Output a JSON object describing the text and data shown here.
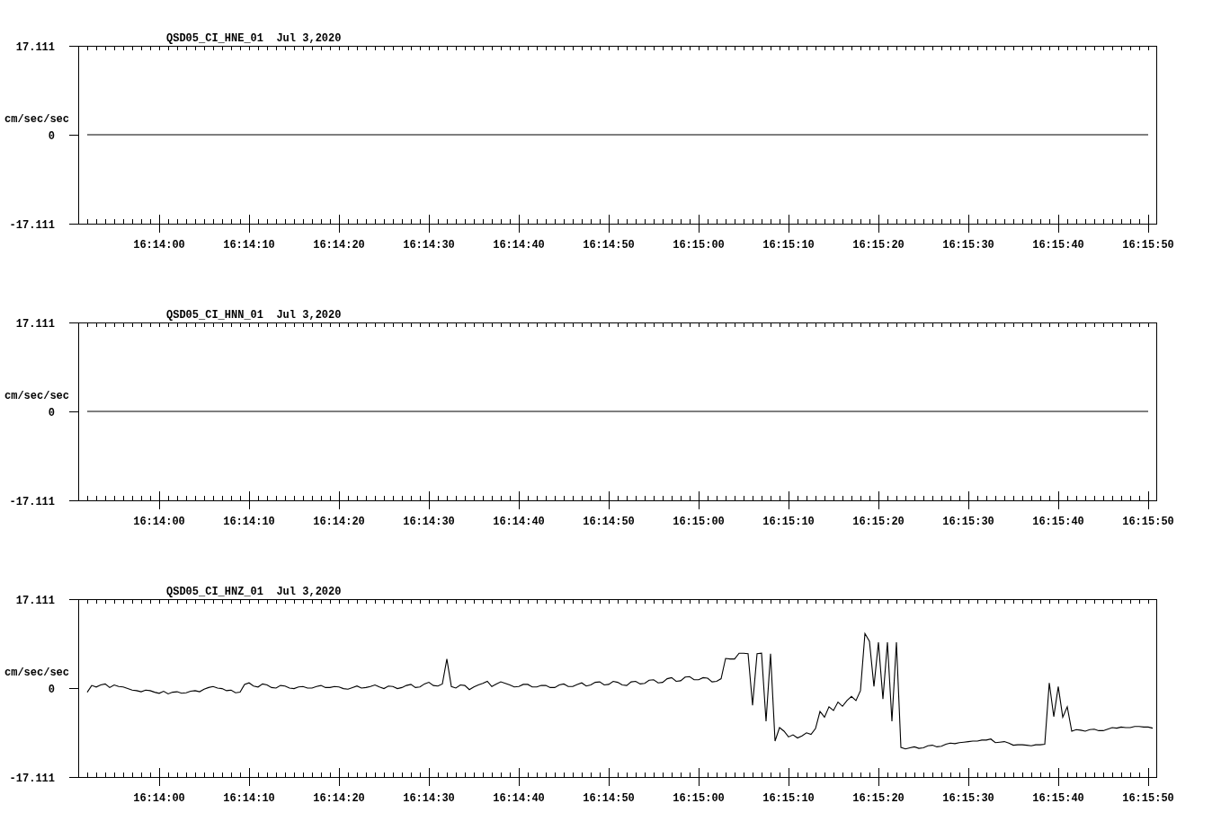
{
  "plots": [
    {
      "chart_data": {
        "type": "line",
        "title": "QSD05_CI_HNE_01  Jul 3,2020",
        "ylabel": "cm/sec/sec",
        "categories": [
          null,
          null,
          null,
          null,
          null,
          null,
          null,
          null,
          "16:14:00",
          null,
          null,
          null,
          null,
          null,
          null,
          null,
          null,
          null,
          "16:14:10",
          null,
          null,
          null,
          null,
          null,
          null,
          null,
          null,
          null,
          "16:14:20",
          null,
          null,
          null,
          null,
          null,
          null,
          null,
          null,
          null,
          "16:14:30",
          null,
          null,
          null,
          null,
          null,
          null,
          null,
          null,
          null,
          "16:14:40",
          null,
          null,
          null,
          null,
          null,
          null,
          null,
          null,
          null,
          "16:14:50",
          null,
          null,
          null,
          null,
          null,
          null,
          null,
          null,
          null,
          "16:15:00",
          null,
          null,
          null,
          null,
          null,
          null,
          null,
          null,
          null,
          "16:15:10",
          null,
          null,
          null,
          null,
          null,
          null,
          null,
          null,
          null,
          "16:15:20",
          null,
          null,
          null,
          null,
          null,
          null,
          null,
          null,
          null,
          "16:15:30",
          null,
          null,
          null,
          null,
          null,
          null,
          null,
          null,
          null,
          "16:15:40",
          null,
          null,
          null,
          null,
          null,
          null,
          null,
          null,
          null,
          "16:15:50"
        ],
        "values": [
          0,
          0,
          0,
          0,
          0,
          0,
          0,
          0,
          0,
          0,
          0,
          0,
          0,
          0,
          0,
          0,
          0,
          0,
          0,
          0,
          0,
          0,
          0,
          0,
          0,
          0,
          0,
          0,
          0,
          0,
          0,
          0,
          0,
          0,
          0,
          0,
          0,
          0,
          0,
          0,
          0,
          0,
          0,
          0,
          0,
          0,
          0,
          0,
          0,
          0,
          0,
          0,
          0,
          0,
          0,
          0,
          0,
          0,
          0,
          0,
          0,
          0,
          0,
          0,
          0,
          0,
          0,
          0,
          0,
          0,
          0,
          0,
          0,
          0,
          0,
          0,
          0,
          0,
          0,
          0,
          0,
          0,
          0,
          0,
          0,
          0,
          0,
          0,
          0,
          0,
          0,
          0,
          0,
          0,
          0,
          0,
          0,
          0,
          0,
          0,
          0,
          0,
          0,
          0,
          0,
          0,
          0,
          0,
          0,
          0,
          0,
          0,
          0,
          0,
          0,
          0,
          0,
          0,
          0
        ],
        "ylim": [
          -17.111,
          17.111
        ],
        "yticks": [
          {
            "value": 17.111,
            "label": "17.111"
          },
          {
            "value": 0,
            "label": "0"
          },
          {
            "value": -17.111,
            "label": "-17.111"
          }
        ]
      }
    },
    {
      "chart_data": {
        "type": "line",
        "title": "QSD05_CI_HNN_01  Jul 3,2020",
        "ylabel": "cm/sec/sec",
        "categories": [
          null,
          null,
          null,
          null,
          null,
          null,
          null,
          null,
          "16:14:00",
          null,
          null,
          null,
          null,
          null,
          null,
          null,
          null,
          null,
          "16:14:10",
          null,
          null,
          null,
          null,
          null,
          null,
          null,
          null,
          null,
          "16:14:20",
          null,
          null,
          null,
          null,
          null,
          null,
          null,
          null,
          null,
          "16:14:30",
          null,
          null,
          null,
          null,
          null,
          null,
          null,
          null,
          null,
          "16:14:40",
          null,
          null,
          null,
          null,
          null,
          null,
          null,
          null,
          null,
          "16:14:50",
          null,
          null,
          null,
          null,
          null,
          null,
          null,
          null,
          null,
          "16:15:00",
          null,
          null,
          null,
          null,
          null,
          null,
          null,
          null,
          null,
          "16:15:10",
          null,
          null,
          null,
          null,
          null,
          null,
          null,
          null,
          null,
          "16:15:20",
          null,
          null,
          null,
          null,
          null,
          null,
          null,
          null,
          null,
          "16:15:30",
          null,
          null,
          null,
          null,
          null,
          null,
          null,
          null,
          null,
          "16:15:40",
          null,
          null,
          null,
          null,
          null,
          null,
          null,
          null,
          null,
          "16:15:50"
        ],
        "values": [
          0,
          0,
          0,
          0,
          0,
          0,
          0,
          0,
          0,
          0,
          0,
          0,
          0,
          0,
          0,
          0,
          0,
          0,
          0,
          0,
          0,
          0,
          0,
          0,
          0,
          0,
          0,
          0,
          0,
          0,
          0,
          0,
          0,
          0,
          0,
          0,
          0,
          0,
          0,
          0,
          0,
          0,
          0,
          0,
          0,
          0,
          0,
          0,
          0,
          0,
          0,
          0,
          0,
          0,
          0,
          0,
          0,
          0,
          0,
          0,
          0,
          0,
          0,
          0,
          0,
          0,
          0,
          0,
          0,
          0,
          0,
          0,
          0,
          0,
          0,
          0,
          0,
          0,
          0,
          0,
          0,
          0,
          0,
          0,
          0,
          0,
          0,
          0,
          0,
          0,
          0,
          0,
          0,
          0,
          0,
          0,
          0,
          0,
          0,
          0,
          0,
          0,
          0,
          0,
          0,
          0,
          0,
          0,
          0,
          0,
          0,
          0,
          0,
          0,
          0,
          0,
          0,
          0,
          0
        ],
        "ylim": [
          -17.111,
          17.111
        ],
        "yticks": [
          {
            "value": 17.111,
            "label": "17.111"
          },
          {
            "value": 0,
            "label": "0"
          },
          {
            "value": -17.111,
            "label": "-17.111"
          }
        ]
      }
    },
    {
      "chart_data": {
        "type": "line",
        "title": "QSD05_CI_HNZ_01  Jul 3,2020",
        "ylabel": "cm/sec/sec",
        "categories": [
          null,
          null,
          null,
          null,
          null,
          null,
          null,
          null,
          null,
          null,
          null,
          null,
          null,
          null,
          null,
          null,
          "16:14:00",
          null,
          null,
          null,
          null,
          null,
          null,
          null,
          null,
          null,
          null,
          null,
          null,
          null,
          null,
          null,
          null,
          null,
          null,
          null,
          "16:14:10",
          null,
          null,
          null,
          null,
          null,
          null,
          null,
          null,
          null,
          null,
          null,
          null,
          null,
          null,
          null,
          null,
          null,
          null,
          null,
          "16:14:20",
          null,
          null,
          null,
          null,
          null,
          null,
          null,
          null,
          null,
          null,
          null,
          null,
          null,
          null,
          null,
          null,
          null,
          null,
          null,
          "16:14:30",
          null,
          null,
          null,
          null,
          null,
          null,
          null,
          null,
          null,
          null,
          null,
          null,
          null,
          null,
          null,
          null,
          null,
          null,
          null,
          "16:14:40",
          null,
          null,
          null,
          null,
          null,
          null,
          null,
          null,
          null,
          null,
          null,
          null,
          null,
          null,
          null,
          null,
          null,
          null,
          null,
          "16:14:50",
          null,
          null,
          null,
          null,
          null,
          null,
          null,
          null,
          null,
          null,
          null,
          null,
          null,
          null,
          null,
          null,
          null,
          null,
          null,
          "16:15:00",
          null,
          null,
          null,
          null,
          null,
          null,
          null,
          null,
          null,
          null,
          null,
          null,
          null,
          null,
          null,
          null,
          null,
          null,
          null,
          "16:15:10",
          null,
          null,
          null,
          null,
          null,
          null,
          null,
          null,
          null,
          null,
          null,
          null,
          null,
          null,
          null,
          null,
          null,
          null,
          null,
          "16:15:20",
          null,
          null,
          null,
          null,
          null,
          null,
          null,
          null,
          null,
          null,
          null,
          null,
          null,
          null,
          null,
          null,
          null,
          null,
          null,
          "16:15:30",
          null,
          null,
          null,
          null,
          null,
          null,
          null,
          null,
          null,
          null,
          null,
          null,
          null,
          null,
          null,
          null,
          null,
          null,
          null,
          "16:15:40",
          null,
          null,
          null,
          null,
          null,
          null,
          null,
          null,
          null,
          null,
          null,
          null,
          null,
          null,
          null,
          null,
          null,
          null,
          null,
          "16:15:50",
          null
        ],
        "values": [
          -0.8,
          0.5,
          0.2,
          0.6,
          0.8,
          0.1,
          0.6,
          0.3,
          0.2,
          -0.1,
          -0.4,
          -0.5,
          -0.7,
          -0.4,
          -0.5,
          -0.8,
          -1.0,
          -0.6,
          -1.1,
          -0.8,
          -0.7,
          -1.0,
          -0.9,
          -0.6,
          -0.5,
          -0.7,
          -0.2,
          0.1,
          0.3,
          0.0,
          -0.1,
          -0.5,
          -0.4,
          -0.9,
          -0.8,
          0.7,
          1.0,
          0.4,
          0.2,
          0.8,
          0.6,
          0.1,
          0.0,
          0.5,
          0.4,
          0.0,
          -0.1,
          0.2,
          0.3,
          0.0,
          0.0,
          0.3,
          0.5,
          0.1,
          0.1,
          0.3,
          0.2,
          -0.1,
          -0.2,
          0.1,
          0.4,
          0.0,
          0.1,
          0.3,
          0.6,
          0.2,
          -0.1,
          0.4,
          0.3,
          -0.1,
          0.1,
          0.5,
          0.7,
          0.1,
          0.2,
          0.8,
          1.1,
          0.5,
          0.4,
          0.8,
          5.6,
          0.3,
          0.0,
          0.6,
          0.5,
          -0.3,
          0.2,
          0.6,
          0.9,
          1.3,
          0.3,
          0.8,
          1.2,
          0.9,
          0.6,
          0.2,
          0.3,
          0.7,
          0.7,
          0.2,
          0.2,
          0.5,
          0.5,
          0.1,
          0.1,
          0.6,
          0.8,
          0.3,
          0.3,
          0.7,
          1.0,
          0.4,
          0.6,
          1.1,
          1.2,
          0.6,
          0.7,
          1.3,
          1.1,
          0.6,
          0.5,
          1.2,
          1.3,
          0.8,
          0.9,
          1.5,
          1.6,
          1.0,
          1.1,
          1.8,
          2.0,
          1.3,
          1.4,
          2.1,
          2.2,
          1.6,
          1.6,
          2.0,
          1.9,
          1.2,
          1.3,
          1.8,
          5.7,
          5.6,
          5.6,
          6.7,
          6.7,
          6.6,
          -3.3,
          6.6,
          6.7,
          -6.4,
          6.6,
          -10.2,
          -7.6,
          -8.3,
          -9.4,
          -9.0,
          -9.6,
          -9.2,
          -8.6,
          -8.9,
          -7.8,
          -4.5,
          -5.6,
          -3.6,
          -4.3,
          -2.7,
          -3.5,
          -2.4,
          -1.6,
          -2.4,
          -0.5,
          10.5,
          9.0,
          0.3,
          8.8,
          -2.1,
          8.8,
          -6.4,
          8.8,
          -11.4,
          -11.7,
          -11.5,
          -11.3,
          -11.6,
          -11.5,
          -11.1,
          -11.0,
          -11.3,
          -11.2,
          -10.8,
          -10.6,
          -10.7,
          -10.5,
          -10.4,
          -10.3,
          -10.2,
          -10.2,
          -10.0,
          -10.0,
          -9.8,
          -10.5,
          -10.4,
          -10.3,
          -10.6,
          -11.0,
          -10.9,
          -10.9,
          -11.0,
          -11.1,
          -10.9,
          -10.9,
          -10.8,
          1.0,
          -5.5,
          0.3,
          -5.6,
          -3.6,
          -8.3,
          -8.0,
          -8.1,
          -8.3,
          -8.0,
          -7.9,
          -8.2,
          -8.2,
          -7.9,
          -7.6,
          -7.7,
          -7.5,
          -7.6,
          -7.6,
          -7.4,
          -7.4,
          -7.5,
          -7.5,
          -7.7
        ],
        "ylim": [
          -17.111,
          17.111
        ],
        "yticks": [
          {
            "value": 17.111,
            "label": "17.111"
          },
          {
            "value": 0,
            "label": "0"
          },
          {
            "value": -17.111,
            "label": "-17.111"
          }
        ]
      }
    }
  ]
}
